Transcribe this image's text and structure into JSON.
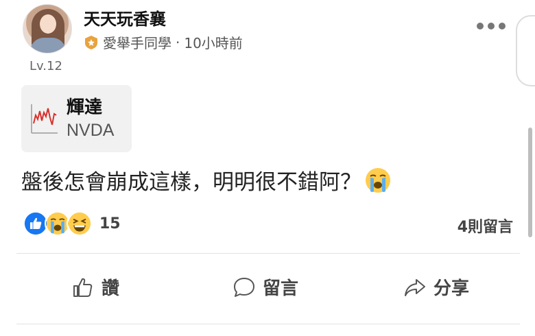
{
  "post": {
    "author": "天天玩香襄",
    "group": "愛舉手同學",
    "separator": "·",
    "time": "10小時前",
    "level": "Lv.12",
    "stock": {
      "name": "輝達",
      "ticker": "NVDA"
    },
    "content": "盤後怎會崩成這樣，明明很不錯阿？",
    "reaction_count": "15",
    "comment_count": "4則留言"
  },
  "actions": {
    "like": "讚",
    "comment": "留言",
    "share": "分享"
  },
  "colors": {
    "like_blue": "#1877F2",
    "emoji_yellow": "#FFCC4D",
    "tear_blue": "#5DADEC",
    "chart_red": "#d9302c",
    "badge_orange": "#E8A33D"
  },
  "icons": [
    "more-icon",
    "group-badge-icon",
    "stock-chart-icon",
    "crying-emoji-icon",
    "like-reaction-icon",
    "laughing-reaction-icon",
    "thumbs-up-icon",
    "speech-bubble-icon",
    "share-arrow-icon"
  ]
}
